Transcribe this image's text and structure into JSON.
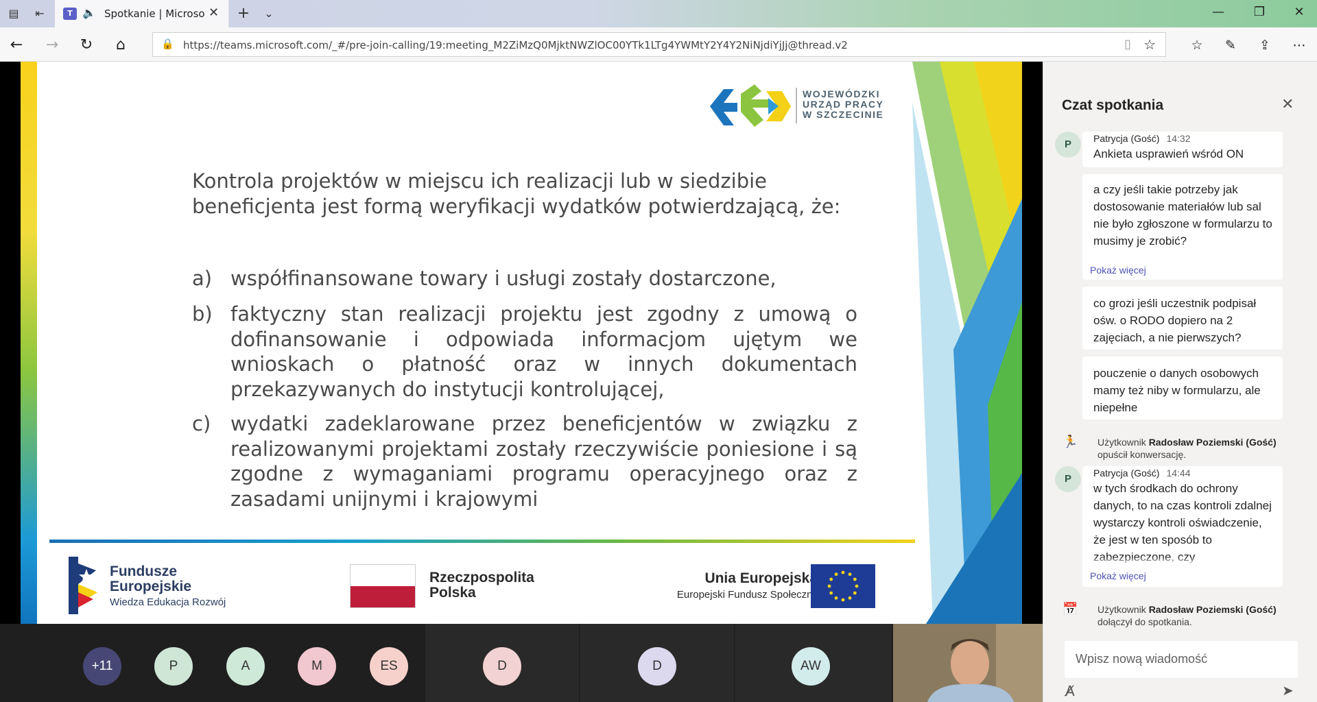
{
  "browser": {
    "tab_title": "Spotkanie | Microsoft Teams",
    "url": "https://teams.microsoft.com/_#/pre-join-calling/19:meeting_M2ZiMzQ0MjktNWZlOC00YTk1LTg4YWMtY2Y4Y2NiNjdiYjJj@thread.v2"
  },
  "slide": {
    "org_logo": [
      "WOJEWÓDZKI",
      "URZĄD PRACY",
      "W SZCZECINIE"
    ],
    "title": "Kontrola projektów w miejscu ich realizacji lub w siedzibie beneficjenta jest formą weryfikacji wydatków potwierdzającą, że:",
    "items": [
      {
        "letter": "a)",
        "text": "współfinansowane towary i usługi zostały dostarczone,"
      },
      {
        "letter": "b)",
        "text": "faktyczny stan realizacji projektu jest zgodny z umową o dofinansowanie i odpowiada informacjom ujętym we wnioskach o płatność oraz w innych dokumentach przekazywanych do instytucji kontrolującej,"
      },
      {
        "letter": "c)",
        "text": "wydatki zadeklarowane przez beneficjentów w związku z realizowanymi projektami zostały rzeczywiście poniesione i są zgodne z wymaganiami programu operacyjnego oraz z zasadami unijnymi i krajowymi"
      }
    ],
    "footer": {
      "fe_line1": "Fundusze",
      "fe_line2": "Europejskie",
      "fe_line3": "Wiedza Edukacja Rozwój",
      "pl_line1": "Rzeczpospolita",
      "pl_line2": "Polska",
      "ue_line1": "Unia Europejska",
      "ue_line2": "Europejski Fundusz Społeczny"
    }
  },
  "participants": [
    {
      "initials": "+11",
      "color": "#464775",
      "text_color": "#ffffff"
    },
    {
      "initials": "P",
      "color": "#cfe6d7",
      "text_color": "#333333"
    },
    {
      "initials": "A",
      "color": "#cfe9d9",
      "text_color": "#333333"
    },
    {
      "initials": "M",
      "color": "#f1c7d0",
      "text_color": "#333333"
    },
    {
      "initials": "ES",
      "color": "#f6d1cb",
      "text_color": "#333333"
    },
    {
      "initials": "D",
      "color": "#f2d2d2",
      "text_color": "#333333"
    },
    {
      "initials": "D",
      "color": "#dcd8ee",
      "text_color": "#333333"
    },
    {
      "initials": "AW",
      "color": "#d2eceb",
      "text_color": "#333333"
    }
  ],
  "chat": {
    "title": "Czat spotkania",
    "messages": [
      {
        "author": "Patrycja (Gość)",
        "time": "14:32",
        "text": "Ankieta usprawień wśród ON",
        "avatar": "P"
      },
      {
        "text": "a czy jeśli takie potrzeby jak dostosowanie materiałów lub sal nie było zgłoszone w formularzu to musimy je zrobić?",
        "more": "Pokaż więcej"
      },
      {
        "text": "co grozi jeśli uczestnik podpisał ośw. o RODO dopiero na 2 zajęciach, a nie pierwszych?"
      },
      {
        "text": "pouczenie o danych osobowych mamy też niby w formularzu, ale niepełne"
      },
      {
        "author": "Patrycja (Gość)",
        "time": "14:44",
        "text": "w tych środkach do ochrony danych, to na czas kontroli zdalnej wystarczy kontroli oświadczenie, że jest w ten sposób to zabezpieczone, czy",
        "avatar": "P",
        "more": "Pokaż więcej"
      }
    ],
    "system": [
      {
        "prefix": "Użytkownik",
        "user": "Radosław Poziemski (Gość)",
        "action": "opuścił konwersację."
      },
      {
        "prefix": "Użytkownik",
        "user": "Radosław Poziemski (Gość)",
        "action": "dołączył do spotkania."
      }
    ],
    "composer_placeholder": "Wpisz nową wiadomość"
  }
}
